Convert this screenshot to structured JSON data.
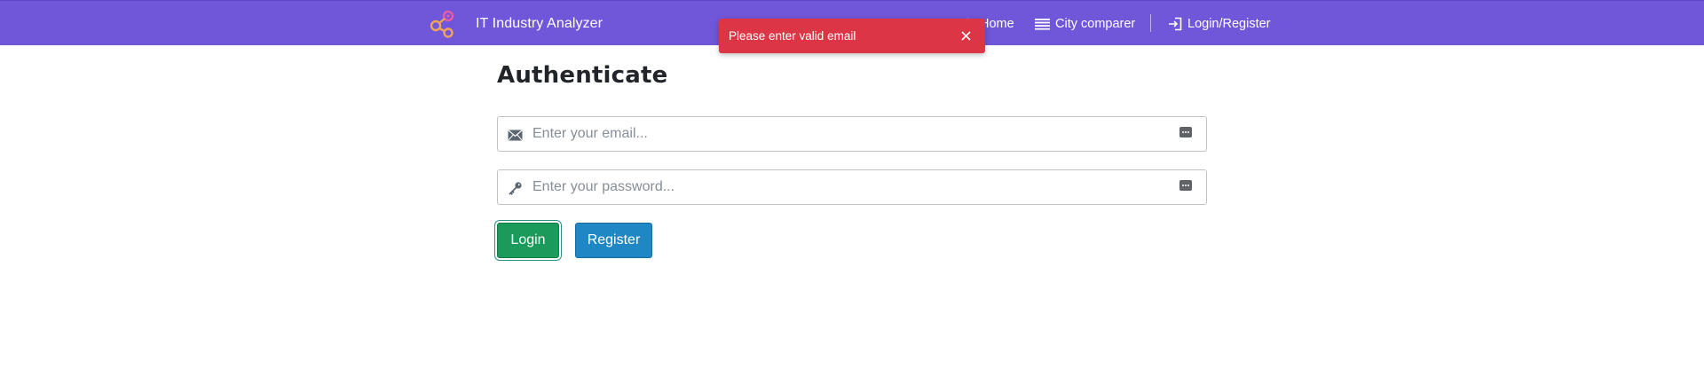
{
  "navbar": {
    "brand": "IT Industry Analyzer",
    "items": [
      {
        "label": "Home",
        "icon": "home-icon"
      },
      {
        "label": "City comparer",
        "icon": "list-icon"
      },
      {
        "label": "Login/Register",
        "icon": "login-icon"
      }
    ]
  },
  "toast": {
    "message": "Please enter valid email",
    "color": "#dc3545"
  },
  "page": {
    "title": "Authenticate"
  },
  "form": {
    "email": {
      "value": "",
      "placeholder": "Enter your email...",
      "icon": "envelope-icon"
    },
    "password": {
      "value": "",
      "placeholder": "Enter your password...",
      "icon": "key-icon"
    },
    "login_label": "Login",
    "register_label": "Register"
  },
  "colors": {
    "navbar": "#7056d8",
    "login_button": "#1a9a5b",
    "register_button": "#1f87c4"
  }
}
